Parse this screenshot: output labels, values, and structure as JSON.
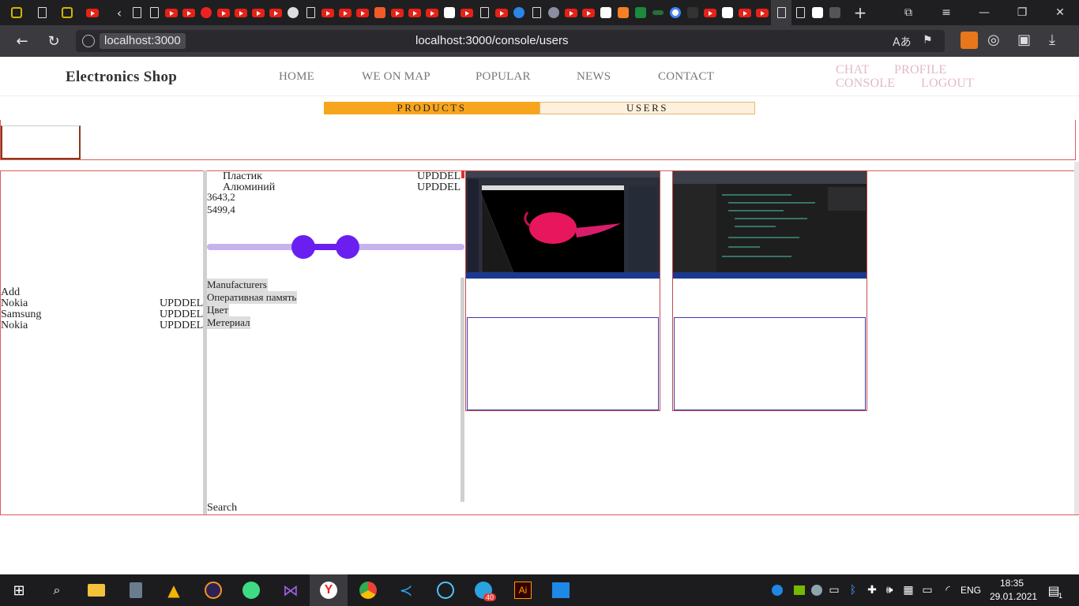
{
  "browser": {
    "url_host": "localhost:3000",
    "url_full": "localhost:3000/console/users"
  },
  "site": {
    "brand": "Electronics Shop",
    "nav": [
      "HOME",
      "WE ON MAP",
      "POPULAR",
      "NEWS",
      "CONTACT"
    ],
    "user_nav": {
      "chat": "CHAT",
      "profile": "PROFILE",
      "console": "CONSOLE",
      "logout": "LOGOUT"
    }
  },
  "console_tabs": {
    "products": "PRODUCTS",
    "users": "USERS"
  },
  "manufacturers_list": {
    "add_label": "Add",
    "items": [
      {
        "name": "Nokia",
        "action": "UPDDEL"
      },
      {
        "name": "Samsung",
        "action": "UPDDEL"
      },
      {
        "name": "Nokia",
        "action": "UPDDEL"
      }
    ]
  },
  "materials_list": {
    "items": [
      {
        "name": "Пластик",
        "action": "UPDDEL"
      },
      {
        "name": "Алюминий",
        "action": "UPDDEL"
      }
    ]
  },
  "price_filter": {
    "min_value": "3643,2",
    "max_value": "5499,4"
  },
  "attributes": [
    "Manufacturers",
    "Оперативная память",
    "Цвет",
    "Метериал"
  ],
  "search_label": "Search",
  "taskbar": {
    "language": "ENG",
    "time": "18:35",
    "date": "29.01.2021",
    "notification_count": "1",
    "telegram_badge": "40"
  }
}
